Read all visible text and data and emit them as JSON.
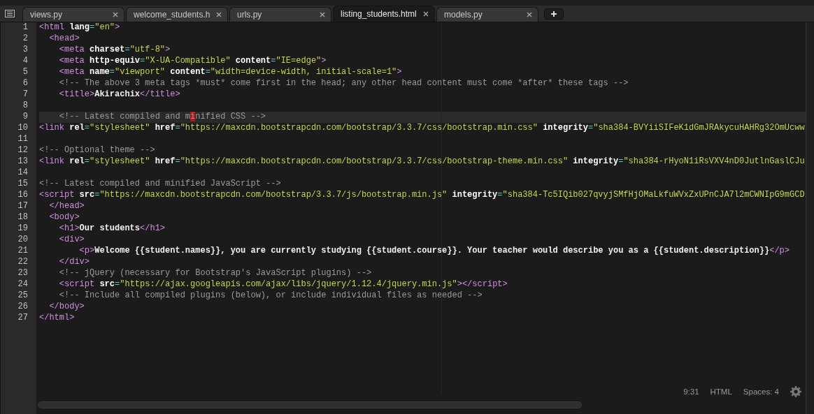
{
  "tabs": [
    {
      "label": "views.py",
      "selected": false
    },
    {
      "label": "welcome_students.h",
      "selected": false
    },
    {
      "label": "urls.py",
      "selected": false
    },
    {
      "label": "listing_students.html",
      "selected": true
    },
    {
      "label": "models.py",
      "selected": false
    }
  ],
  "editor": {
    "lines": [
      {
        "number": "1",
        "current": false,
        "tokens": [
          {
            "kind": "tag",
            "text": "<html "
          },
          {
            "kind": "attr",
            "text": "lang"
          },
          {
            "kind": "eq",
            "text": "="
          },
          {
            "kind": "str",
            "text": "\"en\""
          },
          {
            "kind": "tag",
            "text": ">"
          }
        ]
      },
      {
        "number": "2",
        "current": false,
        "tokens": [
          {
            "kind": "tag",
            "text": "  <head>"
          }
        ]
      },
      {
        "number": "3",
        "current": false,
        "tokens": [
          {
            "kind": "tag",
            "text": "    <meta "
          },
          {
            "kind": "attr",
            "text": "charset"
          },
          {
            "kind": "eq",
            "text": "="
          },
          {
            "kind": "str",
            "text": "\"utf-8\""
          },
          {
            "kind": "tag",
            "text": ">"
          }
        ]
      },
      {
        "number": "4",
        "current": false,
        "tokens": [
          {
            "kind": "tag",
            "text": "    <meta "
          },
          {
            "kind": "attr",
            "text": "http-equiv"
          },
          {
            "kind": "eq",
            "text": "="
          },
          {
            "kind": "str",
            "text": "\"X-UA-Compatible\""
          },
          {
            "kind": "attr",
            "text": " content"
          },
          {
            "kind": "eq",
            "text": "="
          },
          {
            "kind": "str",
            "text": "\"IE=edge\""
          },
          {
            "kind": "tag",
            "text": ">"
          }
        ]
      },
      {
        "number": "5",
        "current": false,
        "tokens": [
          {
            "kind": "tag",
            "text": "    <meta "
          },
          {
            "kind": "attr",
            "text": "name"
          },
          {
            "kind": "eq",
            "text": "="
          },
          {
            "kind": "str",
            "text": "\"viewport\""
          },
          {
            "kind": "attr",
            "text": " content"
          },
          {
            "kind": "eq",
            "text": "="
          },
          {
            "kind": "str",
            "text": "\"width=device-width, initial-scale=1\""
          },
          {
            "kind": "tag",
            "text": ">"
          }
        ]
      },
      {
        "number": "6",
        "current": false,
        "tokens": [
          {
            "kind": "comment",
            "text": "    <!-- The above 3 meta tags *must* come first in the head; any other head content must come *after* these tags -->"
          }
        ]
      },
      {
        "number": "7",
        "current": false,
        "tokens": [
          {
            "kind": "tag",
            "text": "    <title>"
          },
          {
            "kind": "text",
            "text": "Akirachix"
          },
          {
            "kind": "tag",
            "text": "</title>"
          }
        ]
      },
      {
        "number": "8",
        "current": false
      },
      {
        "number": "9",
        "current": true,
        "tokens": [
          {
            "kind": "comment",
            "text": "    <!-- Latest compiled and m"
          },
          {
            "kind": "cursor",
            "text": "i"
          },
          {
            "kind": "comment",
            "text": "nified CSS -->"
          }
        ]
      },
      {
        "number": "10",
        "current": false,
        "tokens": [
          {
            "kind": "tag",
            "text": "<link "
          },
          {
            "kind": "attr",
            "text": "rel"
          },
          {
            "kind": "eq",
            "text": "="
          },
          {
            "kind": "str",
            "text": "\"stylesheet\""
          },
          {
            "kind": "attr",
            "text": " href"
          },
          {
            "kind": "eq",
            "text": "="
          },
          {
            "kind": "str",
            "text": "\"https://maxcdn.bootstrapcdn.com/bootstrap/3.3.7/css/bootstrap.min.css\""
          },
          {
            "kind": "attr",
            "text": " integrity"
          },
          {
            "kind": "eq",
            "text": "="
          },
          {
            "kind": "str",
            "text": "\"sha384-BVYiiSIFeK1dGmJRAkycuHAHRg32OmUcww"
          }
        ]
      },
      {
        "number": "11",
        "current": false
      },
      {
        "number": "12",
        "current": false,
        "tokens": [
          {
            "kind": "comment",
            "text": "<!-- Optional theme -->"
          }
        ]
      },
      {
        "number": "13",
        "current": false,
        "tokens": [
          {
            "kind": "tag",
            "text": "<link "
          },
          {
            "kind": "attr",
            "text": "rel"
          },
          {
            "kind": "eq",
            "text": "="
          },
          {
            "kind": "str",
            "text": "\"stylesheet\""
          },
          {
            "kind": "attr",
            "text": " href"
          },
          {
            "kind": "eq",
            "text": "="
          },
          {
            "kind": "str",
            "text": "\"https://maxcdn.bootstrapcdn.com/bootstrap/3.3.7/css/bootstrap-theme.min.css\""
          },
          {
            "kind": "attr",
            "text": " integrity"
          },
          {
            "kind": "eq",
            "text": "="
          },
          {
            "kind": "str",
            "text": "\"sha384-rHyoN1iRsVXV4nD0JutlnGaslCJu"
          }
        ]
      },
      {
        "number": "14",
        "current": false
      },
      {
        "number": "15",
        "current": false,
        "tokens": [
          {
            "kind": "comment",
            "text": "<!-- Latest compiled and minified JavaScript -->"
          }
        ]
      },
      {
        "number": "16",
        "current": false,
        "tokens": [
          {
            "kind": "tag",
            "text": "<script "
          },
          {
            "kind": "attr",
            "text": "src"
          },
          {
            "kind": "eq",
            "text": "="
          },
          {
            "kind": "str",
            "text": "\"https://maxcdn.bootstrapcdn.com/bootstrap/3.3.7/js/bootstrap.min.js\""
          },
          {
            "kind": "attr",
            "text": " integrity"
          },
          {
            "kind": "eq",
            "text": "="
          },
          {
            "kind": "str",
            "text": "\"sha384-Tc5IQib027qvyjSMfHjOMaLkfuWVxZxUPnCJA7l2mCWNIpG9mGCD"
          }
        ]
      },
      {
        "number": "17",
        "current": false,
        "tokens": [
          {
            "kind": "tag",
            "text": "  </head>"
          }
        ]
      },
      {
        "number": "18",
        "current": false,
        "tokens": [
          {
            "kind": "tag",
            "text": "  <body>"
          }
        ]
      },
      {
        "number": "19",
        "current": false,
        "tokens": [
          {
            "kind": "tag",
            "text": "    <h1>"
          },
          {
            "kind": "text",
            "text": "Our students"
          },
          {
            "kind": "tag",
            "text": "</h1>"
          }
        ]
      },
      {
        "number": "20",
        "current": false,
        "tokens": [
          {
            "kind": "tag",
            "text": "    <div>"
          }
        ]
      },
      {
        "number": "21",
        "current": false,
        "tokens": [
          {
            "kind": "tag",
            "text": "        <p>"
          },
          {
            "kind": "text",
            "text": "Welcome {{student.names}}, you are currently studying {{student.course}}. Your teacher would describe you as a {{student.description}}"
          },
          {
            "kind": "tag",
            "text": "</p>"
          }
        ]
      },
      {
        "number": "22",
        "current": false,
        "tokens": [
          {
            "kind": "tag",
            "text": "    </div>"
          }
        ]
      },
      {
        "number": "23",
        "current": false,
        "tokens": [
          {
            "kind": "comment",
            "text": "    <!-- jQuery (necessary for Bootstrap's JavaScript plugins) -->"
          }
        ]
      },
      {
        "number": "24",
        "current": false,
        "tokens": [
          {
            "kind": "tag",
            "text": "    <script "
          },
          {
            "kind": "attr",
            "text": "src"
          },
          {
            "kind": "eq",
            "text": "="
          },
          {
            "kind": "str",
            "text": "\"https://ajax.googleapis.com/ajax/libs/jquery/1.12.4/jquery.min.js\""
          },
          {
            "kind": "tag",
            "text": "></script>"
          }
        ]
      },
      {
        "number": "25",
        "current": false,
        "tokens": [
          {
            "kind": "comment",
            "text": "    <!-- Include all compiled plugins (below), or include individual files as needed -->"
          }
        ]
      },
      {
        "number": "26",
        "current": false,
        "tokens": [
          {
            "kind": "tag",
            "text": "  </body>"
          }
        ]
      },
      {
        "number": "27",
        "current": false,
        "tokens": [
          {
            "kind": "tag",
            "text": "</html>"
          }
        ]
      }
    ]
  },
  "status_bar": {
    "cursor_position": "9:31",
    "syntax": "HTML",
    "indentation": "Spaces: 4"
  }
}
